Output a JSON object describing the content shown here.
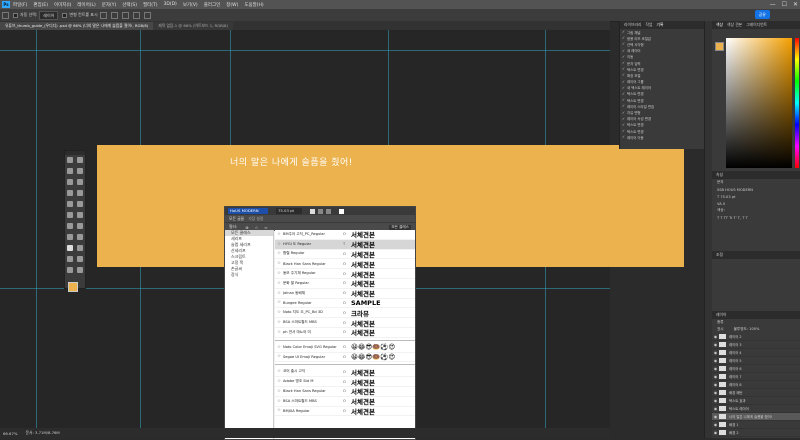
{
  "app": {
    "logo": "Ps"
  },
  "menu": [
    "파일(F)",
    "편집(E)",
    "이미지(I)",
    "레이어(L)",
    "문자(Y)",
    "선택(S)",
    "필터(T)",
    "3D(D)",
    "보기(V)",
    "플러그인",
    "창(W)",
    "도움말(H)"
  ],
  "window_controls": {
    "minimize": "—",
    "maximize": "☐",
    "close": "✕"
  },
  "options": {
    "tool_label": "자동 선택:",
    "select_mode": "레이어",
    "transform_label": "변형 컨트롤 표시",
    "share_label": "공유"
  },
  "tabs": [
    {
      "label": "유튜브_thumb_guide_(우디디) .psd @ 66% (너의 말은 나에게 슬픔을 줬어!, RGB/8)",
      "active": true
    },
    {
      "label": "제목 없음-1 @ 66% (아트보드 1, RGB/8)",
      "active": false
    }
  ],
  "artboard": {
    "text": "너의 말은 나에게 슬픔을 줬어!",
    "color": "#ebb24d"
  },
  "font_panel": {
    "search_value": "HoUS MODERN",
    "size_value": "75.03 pt",
    "tabs": [
      "모든 글꼴",
      "가장 설정"
    ],
    "filter_label": "필터:",
    "filter_right": "모든 클래스",
    "categories": [
      "모든 클래스",
      "세리프",
      "슬랩 세리프",
      "산세리프",
      "스크립트",
      "고정 폭",
      "손글씨",
      "장식"
    ],
    "fonts": [
      {
        "name": "BM주아 고딕_PC_Regular",
        "type": "O",
        "sample": "서체견본"
      },
      {
        "name": "HYGI 도 Regular",
        "type": "T",
        "sample": "서체견본",
        "selected": true
      },
      {
        "name": "함렬 Regular",
        "type": "O",
        "sample": "서체견본"
      },
      {
        "name": "Black Han Sans Regular",
        "type": "O",
        "sample": "서체견본"
      },
      {
        "name": "동모 주기체 Regular",
        "type": "O",
        "sample": "서체견본"
      },
      {
        "name": "문화 팔 Regular",
        "type": "O",
        "sample": "서체견본"
      },
      {
        "name": "Jalnan 동배체",
        "type": "O",
        "sample": "서체견본"
      },
      {
        "name": "Bungee Regular",
        "type": "O",
        "sample": "SAMPLE"
      },
      {
        "name": "Noto 지도 오_PC_Bd 3D",
        "type": "O",
        "sample": "크라뮤"
      },
      {
        "name": "BSA 스마트월드 MBS",
        "type": "O",
        "sample": "서체견본"
      },
      {
        "name": "ph 연서 마뇨어 미",
        "type": "O",
        "sample": "서체견본"
      },
      {
        "name": "Noto Color Emoji SVG Regular",
        "type": "O",
        "sample": "😀😂😎🍩⚽😍"
      },
      {
        "name": "Segoe UI Emoji Regular",
        "type": "O",
        "sample": "😀😂😎🍩⚽😍"
      },
      {
        "name": "코어 출시 고딕",
        "type": "O",
        "sample": "서체견본"
      },
      {
        "name": "Adobe 명조 Std M",
        "type": "O",
        "sample": "서체견본"
      },
      {
        "name": "Black Han Sans Regular",
        "type": "O",
        "sample": "서체견본"
      },
      {
        "name": "BSA 스마트월드 MBS",
        "type": "O",
        "sample": "서체견본"
      },
      {
        "name": "BMJUA Regular",
        "type": "O",
        "sample": "서체견본"
      }
    ]
  },
  "history_panel": {
    "tabs": [
      "라이브러리",
      "작업",
      "기록"
    ],
    "items": [
      "그림 채널",
      "응용 리즈 조절값",
      "선택 사각형",
      "새 레이어",
      "이동",
      "문자 입력",
      "텍스트 변경",
      "확장 조절",
      "레이어 그룹",
      "새 텍스트 레이어",
      "텍스트 변경",
      "텍스트 변경",
      "레이어 스타일 편집",
      "자유 변형",
      "레이어 속성 변경",
      "텍스트 변경",
      "텍스트 변경",
      "레이어 이동"
    ]
  },
  "color_panel": {
    "tabs": [
      "색상",
      "색상 견본",
      "그레이디언트"
    ],
    "fg_color": "#ebb24d"
  },
  "properties_panel": {
    "title": "속성",
    "subtitle": "문자",
    "rows": [
      "SSB HOUS MODERN",
      "T 75.03 pt",
      "VA 0",
      "색상:",
      "T T TT Tr T' T, T T"
    ]
  },
  "adjust_panel": {
    "title": "조정"
  },
  "layers_panel": {
    "title": "레이어",
    "kind_label": "종류",
    "blend": "표시",
    "opacity": "불투명도: 100%",
    "layers": [
      "레이어 2",
      "레이어 3",
      "레이어 4",
      "레이어 5",
      "레이어 6",
      "레이어 7",
      "레이어 8",
      "배경 패턴",
      "텍스트 효과",
      "텍스트 레이어",
      "너의 말은 나에게 슬픔을 줬어!",
      "배경 1",
      "배경 2"
    ]
  },
  "status": {
    "zoom": "66.67%",
    "doc": "문서: 3.71M/8.76M"
  }
}
